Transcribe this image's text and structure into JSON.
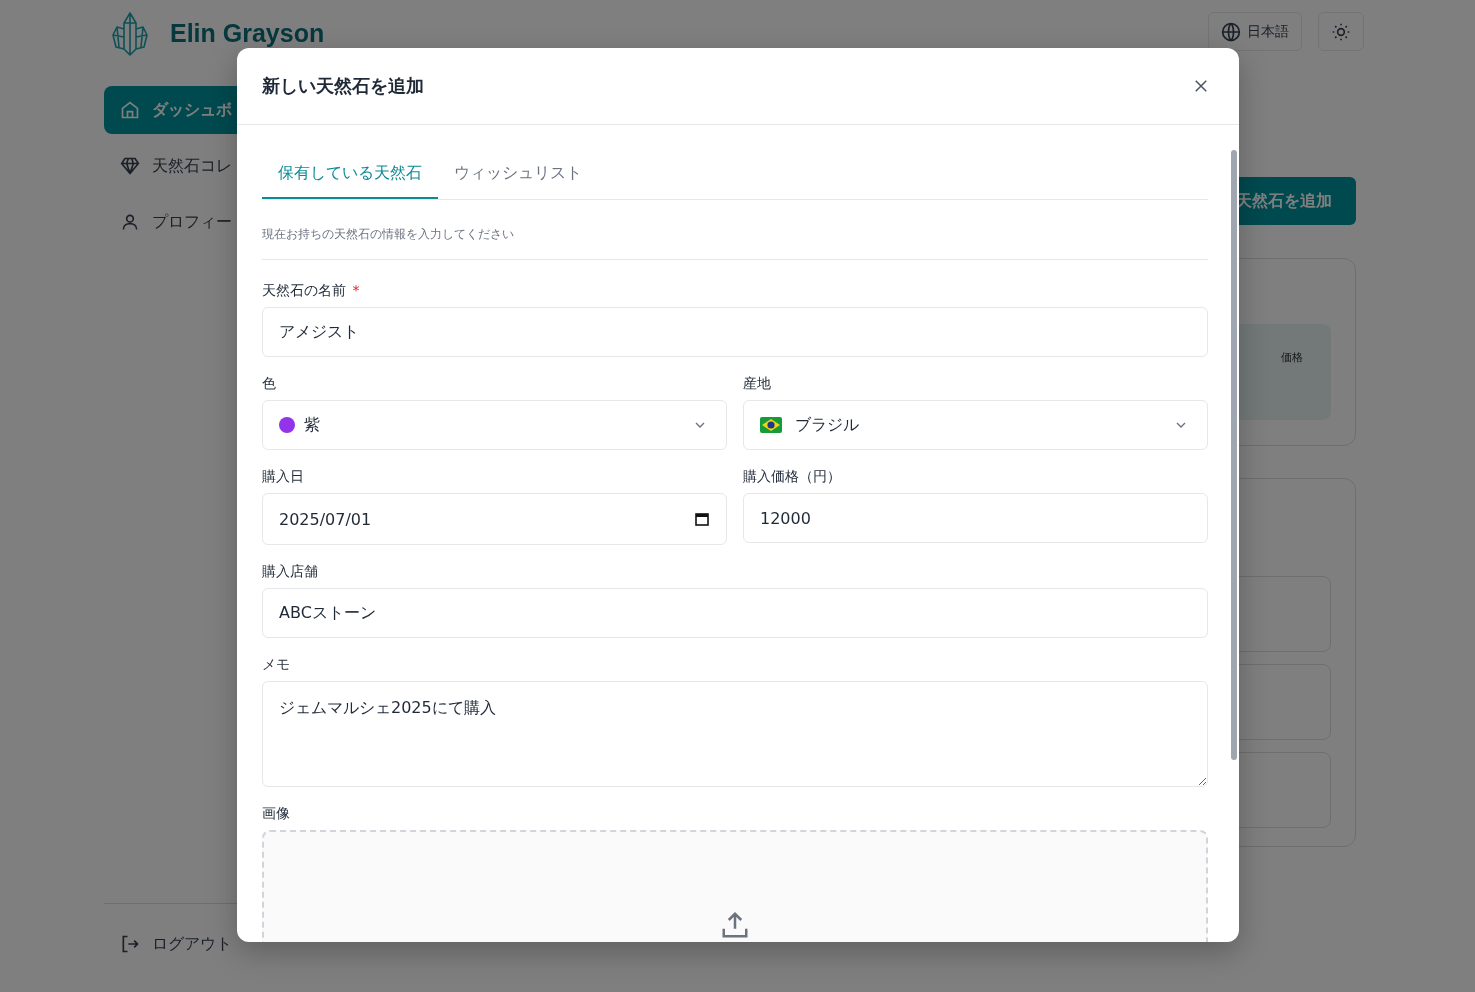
{
  "app": {
    "brand": "Elin Grayson",
    "language_button": "日本語",
    "sidebar": [
      {
        "label": "ダッシュボ",
        "selected": true
      },
      {
        "label": "天然石コレ",
        "selected": false
      },
      {
        "label": "プロフィー",
        "selected": false
      }
    ],
    "logout": "ログアウト",
    "add_button": "天然石を追加",
    "summary_card": {
      "label": "価格"
    }
  },
  "dialog": {
    "title": "新しい天然石を追加",
    "tabs": [
      {
        "label": "保有している天然石",
        "selected": true
      },
      {
        "label": "ウィッシュリスト",
        "selected": false
      }
    ],
    "description": "現在お持ちの天然石の情報を入力してください",
    "rows": [
      [
        {
          "kind": "text",
          "label": "天然石の名前",
          "required_mark": "*",
          "value": "アメジスト"
        }
      ],
      [
        {
          "kind": "color_select",
          "label": "色",
          "value": "紫",
          "color": "#9333ea"
        },
        {
          "kind": "country_select",
          "label": "産地",
          "value": "ブラジル"
        }
      ],
      [
        {
          "kind": "date",
          "label": "購入日",
          "value": "2025/07/01"
        },
        {
          "kind": "text",
          "label": "購入価格（円）",
          "value": "12000"
        }
      ],
      [
        {
          "kind": "text",
          "label": "購入店舗",
          "value": "ABCストーン"
        }
      ],
      [
        {
          "kind": "textarea",
          "label": "メモ",
          "value": "ジェムマルシェ2025にて購入"
        }
      ],
      [
        {
          "kind": "upload",
          "label": "画像"
        }
      ]
    ]
  }
}
